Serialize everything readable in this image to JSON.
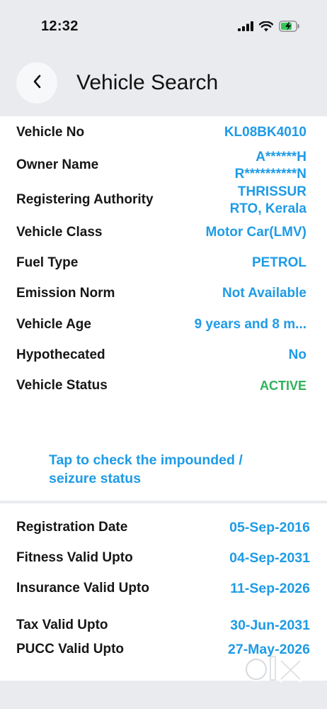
{
  "status_bar": {
    "time": "12:32",
    "icons": [
      "cellular-signal-icon",
      "wifi-icon",
      "battery-charging-icon"
    ]
  },
  "header": {
    "back_icon": "chevron-left-icon",
    "title": "Vehicle Search"
  },
  "vehicle_details": [
    {
      "label": "Vehicle No",
      "value": [
        "KL08BK4010"
      ]
    },
    {
      "label": "Owner Name",
      "value": [
        "A******H",
        "R**********N"
      ]
    },
    {
      "label": "Registering Authority",
      "value": [
        "THRISSUR",
        "RTO, Kerala"
      ]
    },
    {
      "label": "Vehicle Class",
      "value": [
        "Motor Car(LMV)"
      ]
    },
    {
      "label": "Fuel Type",
      "value": [
        "PETROL"
      ]
    },
    {
      "label": "Emission Norm",
      "value": [
        "Not Available"
      ]
    },
    {
      "label": "Vehicle Age",
      "value": [
        "9 years and 8 m..."
      ]
    },
    {
      "label": "Hypothecated",
      "value": [
        "No"
      ]
    },
    {
      "label": "Vehicle Status",
      "value": [
        "ACTIVE"
      ]
    }
  ],
  "impound_link": {
    "line1": "Tap to check the impounded /",
    "line2": "seizure status"
  },
  "validity_details": [
    {
      "label": "Registration Date",
      "value": "05-Sep-2016"
    },
    {
      "label": "Fitness Valid Upto",
      "value": "04-Sep-2031"
    },
    {
      "label": "Insurance Valid Upto",
      "value": "11-Sep-2026"
    },
    {
      "label": "Tax Valid Upto",
      "value": "30-Jun-2031"
    },
    {
      "label": "PUCC Valid Upto",
      "value": "27-May-2026"
    }
  ],
  "watermark": {
    "text": "OLX",
    "icon": "olx-logo-watermark"
  },
  "colors": {
    "background": "#e9ebee",
    "card": "#ffffff",
    "label": "#161616",
    "value_blue": "#1e9be6",
    "status_green": "#2fb25a",
    "battery_green": "#34c759"
  }
}
